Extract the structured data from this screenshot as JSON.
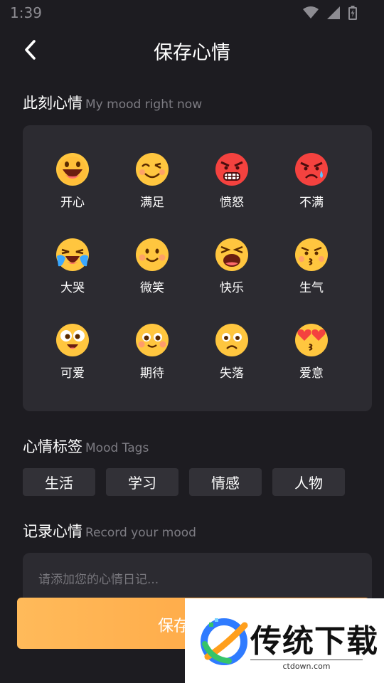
{
  "status": {
    "time": "1:39"
  },
  "header": {
    "title": "保存心情"
  },
  "mood_section": {
    "title": "此刻心情",
    "subtitle": "My mood right now"
  },
  "moods": [
    {
      "label": "开心",
      "icon": "grinning-face-icon"
    },
    {
      "label": "满足",
      "icon": "satisfied-face-icon"
    },
    {
      "label": "愤怒",
      "icon": "angry-red-face-icon"
    },
    {
      "label": "不满",
      "icon": "frustrated-red-face-icon"
    },
    {
      "label": "大哭",
      "icon": "crying-face-icon"
    },
    {
      "label": "微笑",
      "icon": "smiling-face-icon"
    },
    {
      "label": "快乐",
      "icon": "laughing-face-icon"
    },
    {
      "label": "生气",
      "icon": "annoyed-face-icon"
    },
    {
      "label": "可爱",
      "icon": "cute-face-icon"
    },
    {
      "label": "期待",
      "icon": "expectant-face-icon"
    },
    {
      "label": "失落",
      "icon": "sad-face-icon"
    },
    {
      "label": "爱意",
      "icon": "heart-eyes-face-icon"
    }
  ],
  "tags_section": {
    "title": "心情标签",
    "subtitle": "Mood Tags"
  },
  "tags": [
    "生活",
    "学习",
    "情感",
    "人物"
  ],
  "record_section": {
    "title": "记录心情",
    "subtitle": "Record your mood"
  },
  "note": {
    "placeholder": "请添加您的心情日记...",
    "value": ""
  },
  "save_button": {
    "label": "保存"
  },
  "watermark": {
    "text": "传统下载",
    "url": "ctdown.com"
  },
  "colors": {
    "background": "#1d1c21",
    "panel": "#2c2b31",
    "accent": "#ffa846",
    "muted": "#7d7c83"
  }
}
